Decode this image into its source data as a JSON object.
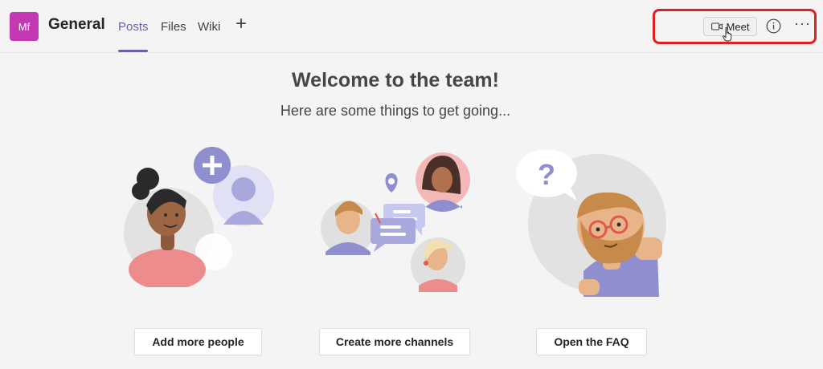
{
  "header": {
    "team_initials": "Mf",
    "channel_name": "General",
    "tabs": [
      {
        "label": "Posts",
        "active": true
      },
      {
        "label": "Files",
        "active": false
      },
      {
        "label": "Wiki",
        "active": false
      }
    ],
    "add_tab_symbol": "+",
    "meet_label": "Meet",
    "more_symbol": "···"
  },
  "colors": {
    "accent": "#6264a7",
    "team_avatar": "#c239b3",
    "highlight": "#e02020",
    "lavender": "#8f8fcf"
  },
  "main": {
    "title": "Welcome to the team!",
    "subtitle": "Here are some things to get going...",
    "actions": [
      {
        "label": "Add more people",
        "icon": "add-people-illustration"
      },
      {
        "label": "Create more channels",
        "icon": "channels-illustration"
      },
      {
        "label": "Open the FAQ",
        "icon": "faq-illustration"
      }
    ]
  }
}
